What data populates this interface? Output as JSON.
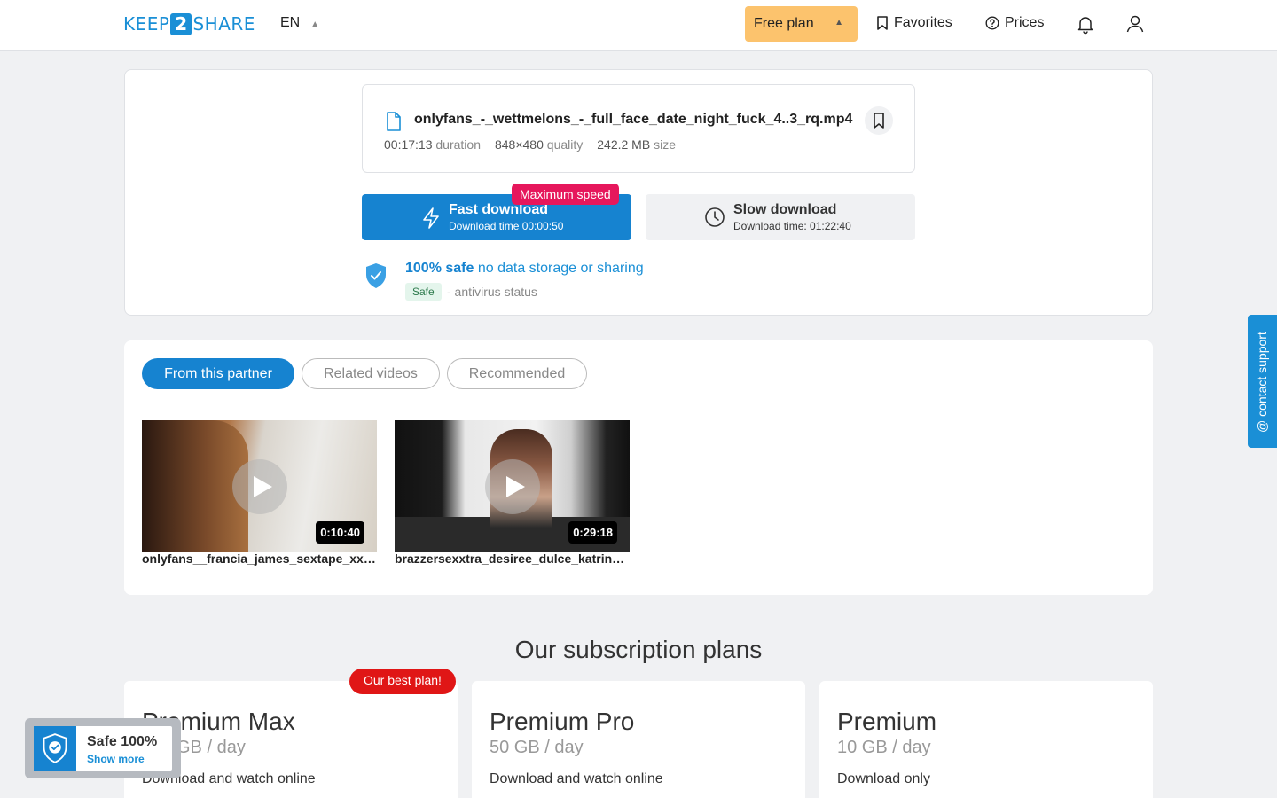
{
  "header": {
    "logo_left": "KEEP",
    "logo_mid": "2",
    "logo_right": "SHARE",
    "lang": "EN",
    "plan_label": "Free plan",
    "favorites": "Favorites",
    "prices": "Prices"
  },
  "file": {
    "name": "onlyfans_-_wettmelons_-_full_face_date_night_fuck_4..3_rq.mp4",
    "duration_value": "00:17:13",
    "duration_label": "duration",
    "quality_value": "848×480",
    "quality_label": "quality",
    "size_value": "242.2 MB",
    "size_label": "size"
  },
  "download": {
    "badge": "Maximum speed",
    "fast_title": "Fast download",
    "fast_sub": "Download time 00:00:50",
    "slow_title": "Slow download",
    "slow_sub": "Download time: 01:22:40"
  },
  "safety": {
    "title_bold": "100% safe",
    "title_rest": " no data storage or sharing",
    "badge": "Safe",
    "status": "- antivirus status"
  },
  "tabs": [
    "From this partner",
    "Related videos",
    "Recommended"
  ],
  "videos": [
    {
      "title": "onlyfans__francia_james_sextape_xxx_...",
      "duration": "0:10:40"
    },
    {
      "title": "brazzersexxtra_desiree_dulce_katrina_...",
      "duration": "0:29:18"
    }
  ],
  "plans": {
    "title": "Our subscription plans",
    "best_badge": "Our best plan!",
    "items": [
      {
        "name": "Premium Max",
        "quota": "GB / day",
        "desc": "Download and watch online"
      },
      {
        "name": "Premium Pro",
        "quota": "50 GB / day",
        "desc": "Download and watch online"
      },
      {
        "name": "Premium",
        "quota": "10 GB / day",
        "desc": "Download only"
      }
    ]
  },
  "support": {
    "label": "@ contact support"
  },
  "widget": {
    "title": "Safe 100%",
    "link": "Show more"
  },
  "colors": {
    "brand": "#1683d0",
    "plan": "#fcc36d",
    "badge": "#e6175c",
    "best": "#e01616"
  }
}
